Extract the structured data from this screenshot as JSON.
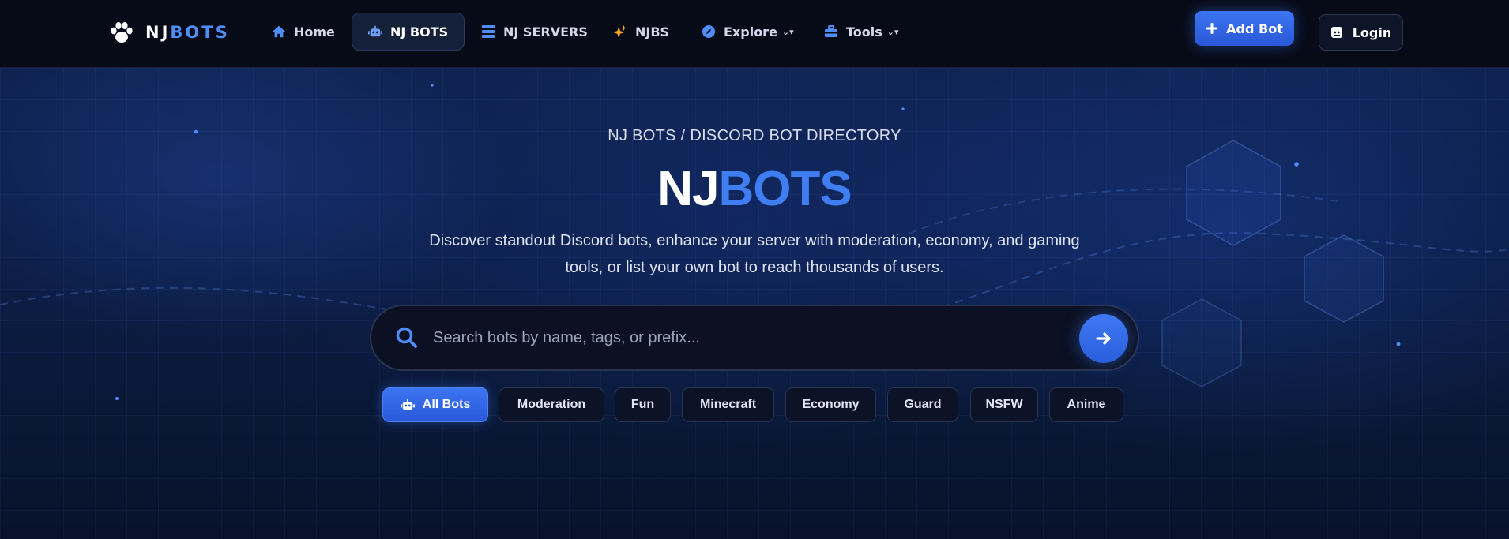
{
  "brand": {
    "part1": "NJ",
    "part2": "BOTS"
  },
  "nav": {
    "items": [
      {
        "label": "Home",
        "icon": "home-icon"
      },
      {
        "label": "NJ BOTS",
        "icon": "robot-icon",
        "active": true
      },
      {
        "label": "NJ SERVERS",
        "icon": "server-icon"
      },
      {
        "label": "NJBS",
        "icon": "sparkles-icon"
      },
      {
        "label": "Explore",
        "icon": "compass-icon",
        "dropdown": true
      },
      {
        "label": "Tools",
        "icon": "toolbox-icon",
        "dropdown": true
      }
    ],
    "add_bot": "Add Bot",
    "login": "Login"
  },
  "hero": {
    "kicker": "NJ BOTS / DISCORD BOT DIRECTORY",
    "title_part1": "NJ",
    "title_part2": "BOTS",
    "description": "Discover standout Discord bots, enhance your server with moderation, economy, and gaming tools, or list your own bot to reach thousands of users."
  },
  "search": {
    "placeholder": "Search bots by name, tags, or prefix...",
    "value": ""
  },
  "categories": [
    {
      "label": "All Bots",
      "active": true,
      "icon": "robot-icon"
    },
    {
      "label": "Moderation"
    },
    {
      "label": "Fun"
    },
    {
      "label": "Minecraft"
    },
    {
      "label": "Economy"
    },
    {
      "label": "Guard"
    },
    {
      "label": "NSFW"
    },
    {
      "label": "Anime"
    }
  ],
  "colors": {
    "accent": "#3f7ef0",
    "background": "#0a1022",
    "navbar": "#070b17"
  }
}
